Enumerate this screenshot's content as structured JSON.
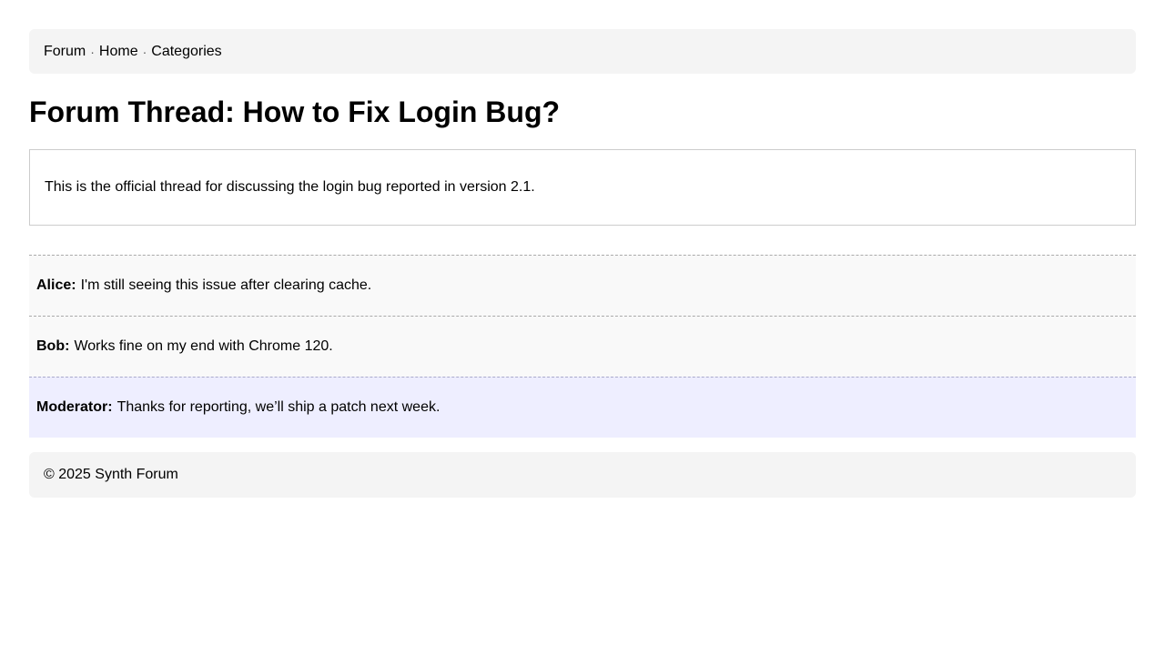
{
  "nav": {
    "items": [
      "Forum",
      "Home",
      "Categories"
    ],
    "separator": "·"
  },
  "thread": {
    "title": "Forum Thread: How to Fix Login Bug?",
    "body": "This is the official thread for discussing the login bug reported in version 2.1."
  },
  "replies": [
    {
      "author": "Alice:",
      "text": "I'm still seeing this issue after clearing cache."
    },
    {
      "author": "Bob:",
      "text": "Works fine on my end with Chrome 120."
    },
    {
      "author": "Moderator:",
      "text": "Thanks for reporting, we’ll ship a patch next week."
    }
  ],
  "footer": {
    "text": "© 2025 Synth Forum"
  }
}
